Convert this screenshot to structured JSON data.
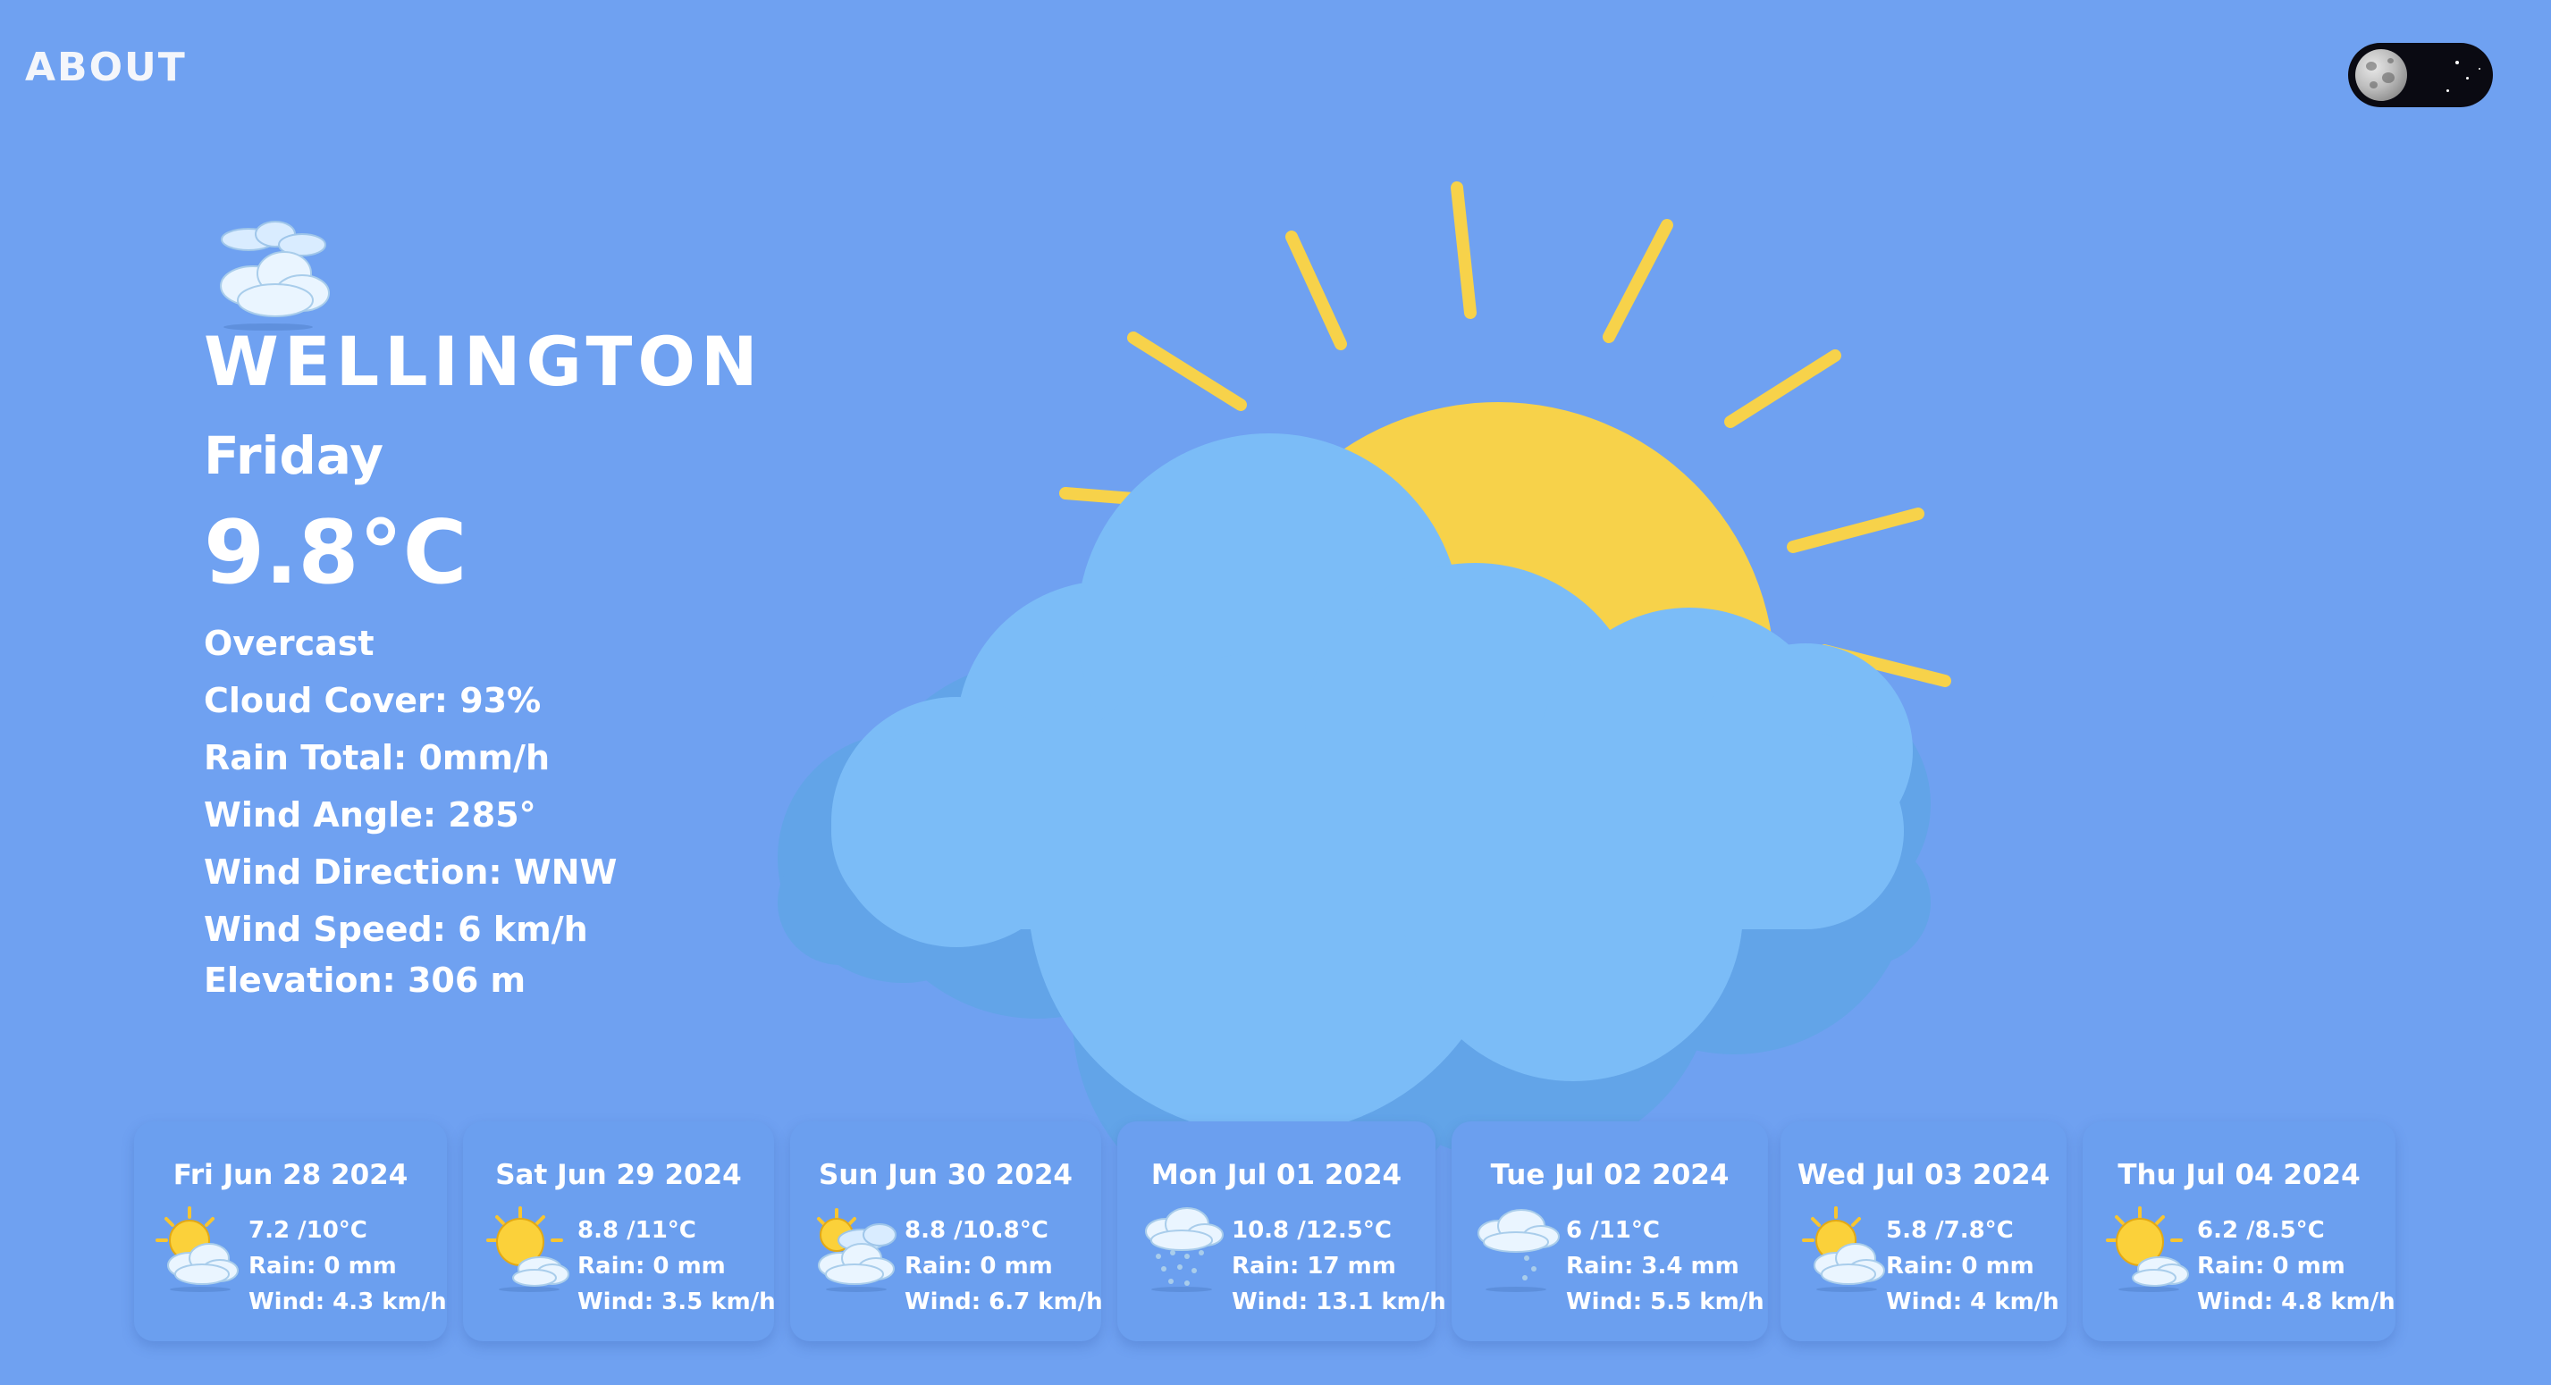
{
  "header": {
    "about_label": "ABOUT",
    "theme_toggle": "dark-mode-moon-icon"
  },
  "current": {
    "icon": "cloudy-icon",
    "city": "WELLINGTON",
    "day": "Friday",
    "temperature": "9.8°C",
    "condition": "Overcast",
    "cloud_cover": "Cloud Cover: 93%",
    "rain_total": "Rain Total: 0mm/h",
    "wind_angle": "Wind Angle: 285°",
    "wind_direction": "Wind Direction: WNW",
    "wind_speed": "Wind Speed: 6 km/h",
    "elevation": "Elevation: 306 m"
  },
  "hero_icon": "sun-behind-cloud-icon",
  "colors": {
    "background": "#6fa1f1",
    "sun": "#f7d24a",
    "cloud": "#7bbcf7",
    "cloud_shadow": "#62a4e8"
  },
  "forecast": [
    {
      "date": "Fri Jun 28 2024",
      "icon": "partly-cloudy-icon",
      "temp": "7.2 /10°C",
      "rain": "Rain: 0 mm",
      "wind": "Wind: 4.3 km/h"
    },
    {
      "date": "Sat Jun 29 2024",
      "icon": "sun-behind-cloud-icon",
      "temp": "8.8 /11°C",
      "rain": "Rain: 0 mm",
      "wind": "Wind: 3.5 km/h"
    },
    {
      "date": "Sun Jun 30 2024",
      "icon": "mostly-cloudy-icon",
      "temp": "8.8 /10.8°C",
      "rain": "Rain: 0 mm",
      "wind": "Wind: 6.7 km/h"
    },
    {
      "date": "Mon Jul 01 2024",
      "icon": "rain-cloud-icon",
      "temp": "10.8 /12.5°C",
      "rain": "Rain: 17 mm",
      "wind": "Wind: 13.1 km/h"
    },
    {
      "date": "Tue Jul 02 2024",
      "icon": "light-rain-cloud-icon",
      "temp": "6 /11°C",
      "rain": "Rain: 3.4 mm",
      "wind": "Wind: 5.5 km/h"
    },
    {
      "date": "Wed Jul 03 2024",
      "icon": "partly-cloudy-icon",
      "temp": "5.8 /7.8°C",
      "rain": "Rain: 0 mm",
      "wind": "Wind: 4 km/h"
    },
    {
      "date": "Thu Jul 04 2024",
      "icon": "sun-behind-cloud-icon",
      "temp": "6.2 /8.5°C",
      "rain": "Rain: 0 mm",
      "wind": "Wind: 4.8 km/h"
    }
  ]
}
